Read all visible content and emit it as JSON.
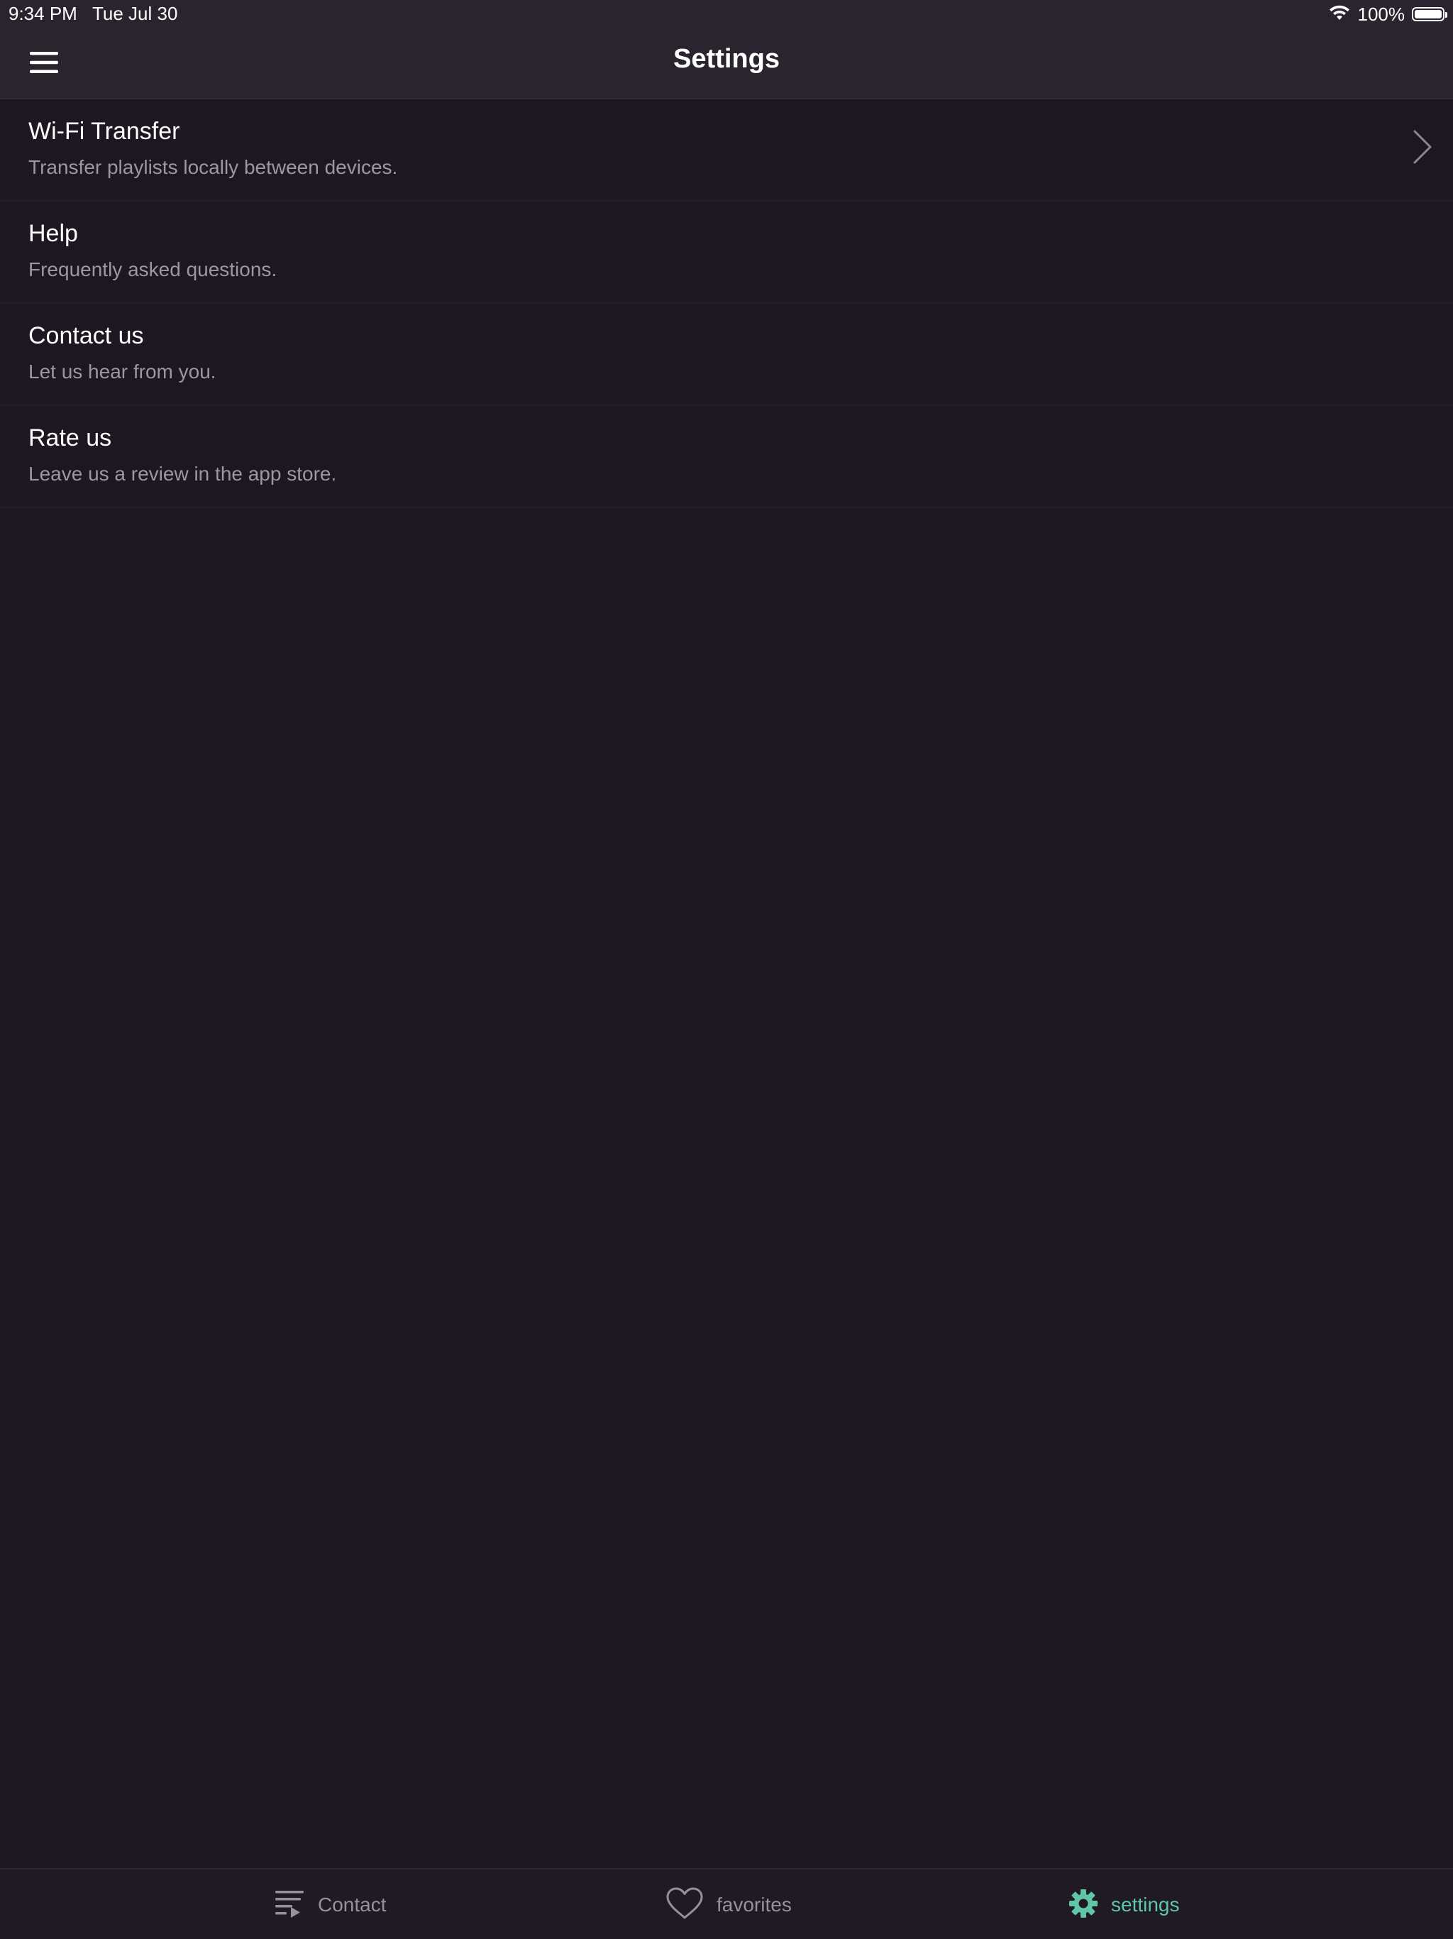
{
  "status_bar": {
    "time": "9:34 PM",
    "date": "Tue Jul 30",
    "battery_percent_label": "100%",
    "battery_level": 1.0,
    "icons": [
      "wifi-icon",
      "battery-icon"
    ]
  },
  "header": {
    "title": "Settings",
    "menu_icon": "hamburger-menu-icon"
  },
  "settings": {
    "items": [
      {
        "title": "Wi-Fi Transfer",
        "subtitle": "Transfer playlists locally between devices.",
        "has_chevron": true
      },
      {
        "title": "Help",
        "subtitle": "Frequently asked questions."
      },
      {
        "title": "Contact us",
        "subtitle": "Let us hear from you."
      },
      {
        "title": "Rate us",
        "subtitle": "Leave us a review in the app store."
      }
    ]
  },
  "tab_bar": {
    "tabs": [
      {
        "label": "Contact",
        "icon": "playlist-icon",
        "active": false
      },
      {
        "label": "favorites",
        "icon": "heart-icon",
        "active": false
      },
      {
        "label": "settings",
        "icon": "gear-icon",
        "active": true
      }
    ]
  },
  "colors": {
    "background": "#1c1720",
    "header_background": "#29242d",
    "accent": "#5fc7a5",
    "secondary_text": "#9d97a3",
    "inactive_tab": "#97919d"
  }
}
